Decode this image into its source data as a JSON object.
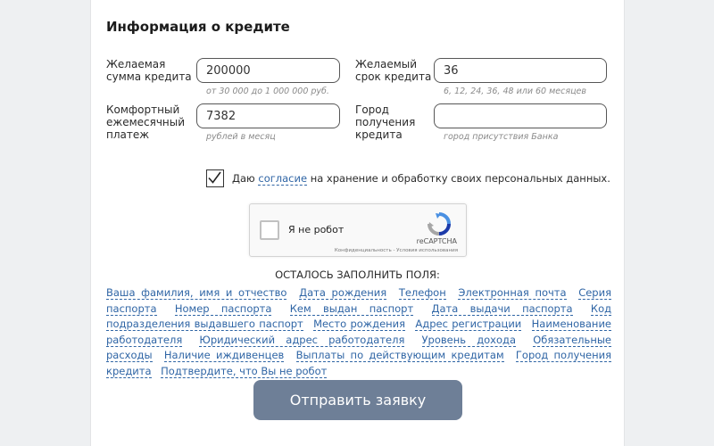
{
  "form": {
    "title": "Информация о кредите",
    "fields": {
      "amount": {
        "label_line1": "Желаемая",
        "label_line2": "сумма кредита",
        "value": "200000",
        "hint": "от 30 000 до 1 000 000 руб."
      },
      "term": {
        "label_line1": "Желаемый",
        "label_line2": "срок кредита",
        "value": "36",
        "hint": "6, 12, 24, 36, 48 или 60 месяцев"
      },
      "payment": {
        "label_line1": "Комфортный",
        "label_line2": "ежемесячный",
        "label_line3": "платеж",
        "value": "7382",
        "hint": "рублей в месяц"
      },
      "city": {
        "label_line1": "Город",
        "label_line2": "получения",
        "label_line3": "кредита",
        "value": "",
        "hint": "город присутствия Банка"
      }
    },
    "consent": {
      "before": "Даю ",
      "link": "согласие",
      "after": " на хранение и обработку своих персональных данных.",
      "checked": true
    },
    "captcha": {
      "label": "Я не робот",
      "brand": "reCAPTCHA",
      "terms": "Конфиденциальность - Условия использования"
    },
    "remaining": {
      "title": "ОСТАЛОСЬ ЗАПОЛНИТЬ ПОЛЯ:",
      "items": [
        "Ваша фамилия, имя и отчество",
        "Дата рождения",
        "Телефон",
        "Электронная почта",
        "Серия паспорта",
        "Номер паспорта",
        "Кем выдан паспорт",
        "Дата выдачи паспорта",
        "Код подразделения выдавшего паспорт",
        "Место рождения",
        "Адрес регистрации",
        "Наименование работодателя",
        "Юридический адрес работодателя",
        "Уровень дохода",
        "Обязательные расходы",
        "Наличие иждивенцев",
        "Выплаты по действующим кредитам",
        "Город получения кредита",
        "Подтвердите, что Вы не робот"
      ]
    },
    "submit_label": "Отправить заявку"
  },
  "colors": {
    "link": "#2f65a5",
    "submit_bg": "#6e7f97",
    "page_bg": "#eef0f2"
  }
}
